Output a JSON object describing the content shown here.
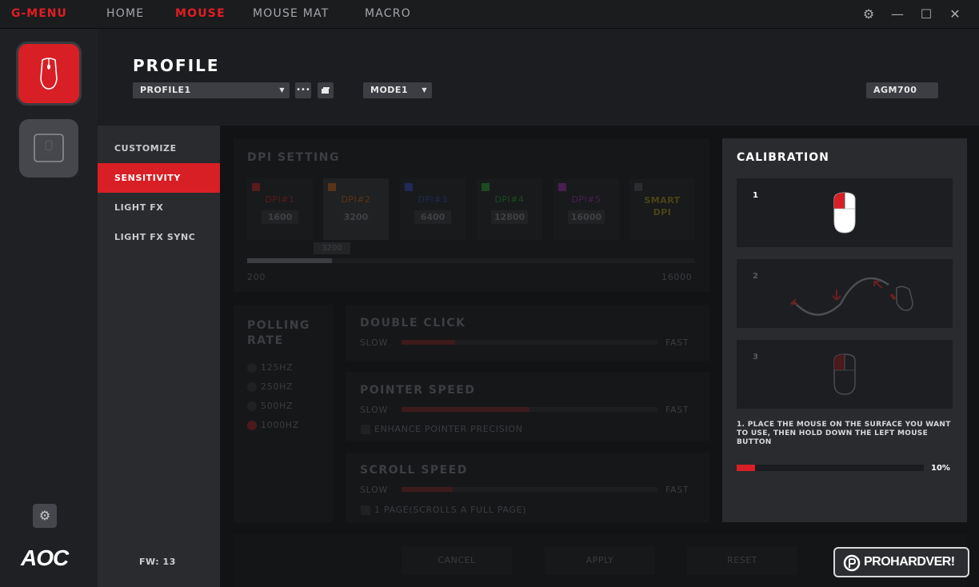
{
  "app": {
    "brand": "G-MENU",
    "nav": [
      "HOME",
      "MOUSE",
      "MOUSE MAT",
      "MACRO"
    ],
    "active_nav": "MOUSE",
    "icons": {
      "settings": "gear-icon",
      "minimize": "minimize-icon",
      "maximize": "maximize-icon",
      "close": "close-icon"
    }
  },
  "rail": {
    "logo": "AOC",
    "accent": "#d81f25"
  },
  "header": {
    "title": "PROFILE",
    "profile_select": "PROFILE1",
    "more_label": "•••",
    "mode_select": "MODE1",
    "device_model": "AGM700"
  },
  "submenu": {
    "items": [
      "CUSTOMIZE",
      "SENSITIVITY",
      "LIGHT FX",
      "LIGHT FX SYNC"
    ],
    "active": "SENSITIVITY",
    "fw": "FW: 13"
  },
  "dpi": {
    "title": "DPI SETTING",
    "stages": [
      {
        "name": "DPI#1",
        "value": "1600",
        "color": "#5a1a1c"
      },
      {
        "name": "DPI#2",
        "value": "3200",
        "color": "#5a3418"
      },
      {
        "name": "DPI#3",
        "value": "6400",
        "color": "#1f2a55"
      },
      {
        "name": "DPI#4",
        "value": "12800",
        "color": "#1d4a22"
      },
      {
        "name": "DPI#5",
        "value": "16000",
        "color": "#4a1f4f"
      },
      {
        "name": "SMART\nDPI",
        "value": "",
        "color": "#4a4416"
      }
    ],
    "slider_value": "3200",
    "slider_fraction": 0.19,
    "min": "200",
    "max": "16000"
  },
  "polling": {
    "title": "POLLING RATE",
    "options": [
      "125HZ",
      "250HZ",
      "500HZ",
      "1000HZ"
    ],
    "selected": "1000HZ"
  },
  "double_click": {
    "title": "DOUBLE CLICK",
    "slow": "SLOW",
    "fast": "FAST",
    "level": 0.21
  },
  "pointer": {
    "title": "POINTER SPEED",
    "slow": "SLOW",
    "fast": "FAST",
    "level": 0.5,
    "checkbox": "ENHANCE POINTER PRECISION"
  },
  "scroll": {
    "title": "SCROLL SPEED",
    "slow": "SLOW",
    "fast": "FAST",
    "level": 0.2,
    "checkbox": "1 PAGE(SCROLLS A FULL PAGE)"
  },
  "actions": {
    "cancel": "CANCEL",
    "apply": "APPLY",
    "reset": "RESET"
  },
  "calibration": {
    "title": "CALIBRATION",
    "steps": [
      "1",
      "2",
      "3"
    ],
    "instruction": "1. PLACE THE MOUSE ON THE SURFACE YOU WANT TO USE, THEN HOLD DOWN THE LEFT MOUSE BUTTON",
    "progress": 0.1,
    "progress_label": "10%"
  },
  "watermark": "PROHARDVER!"
}
